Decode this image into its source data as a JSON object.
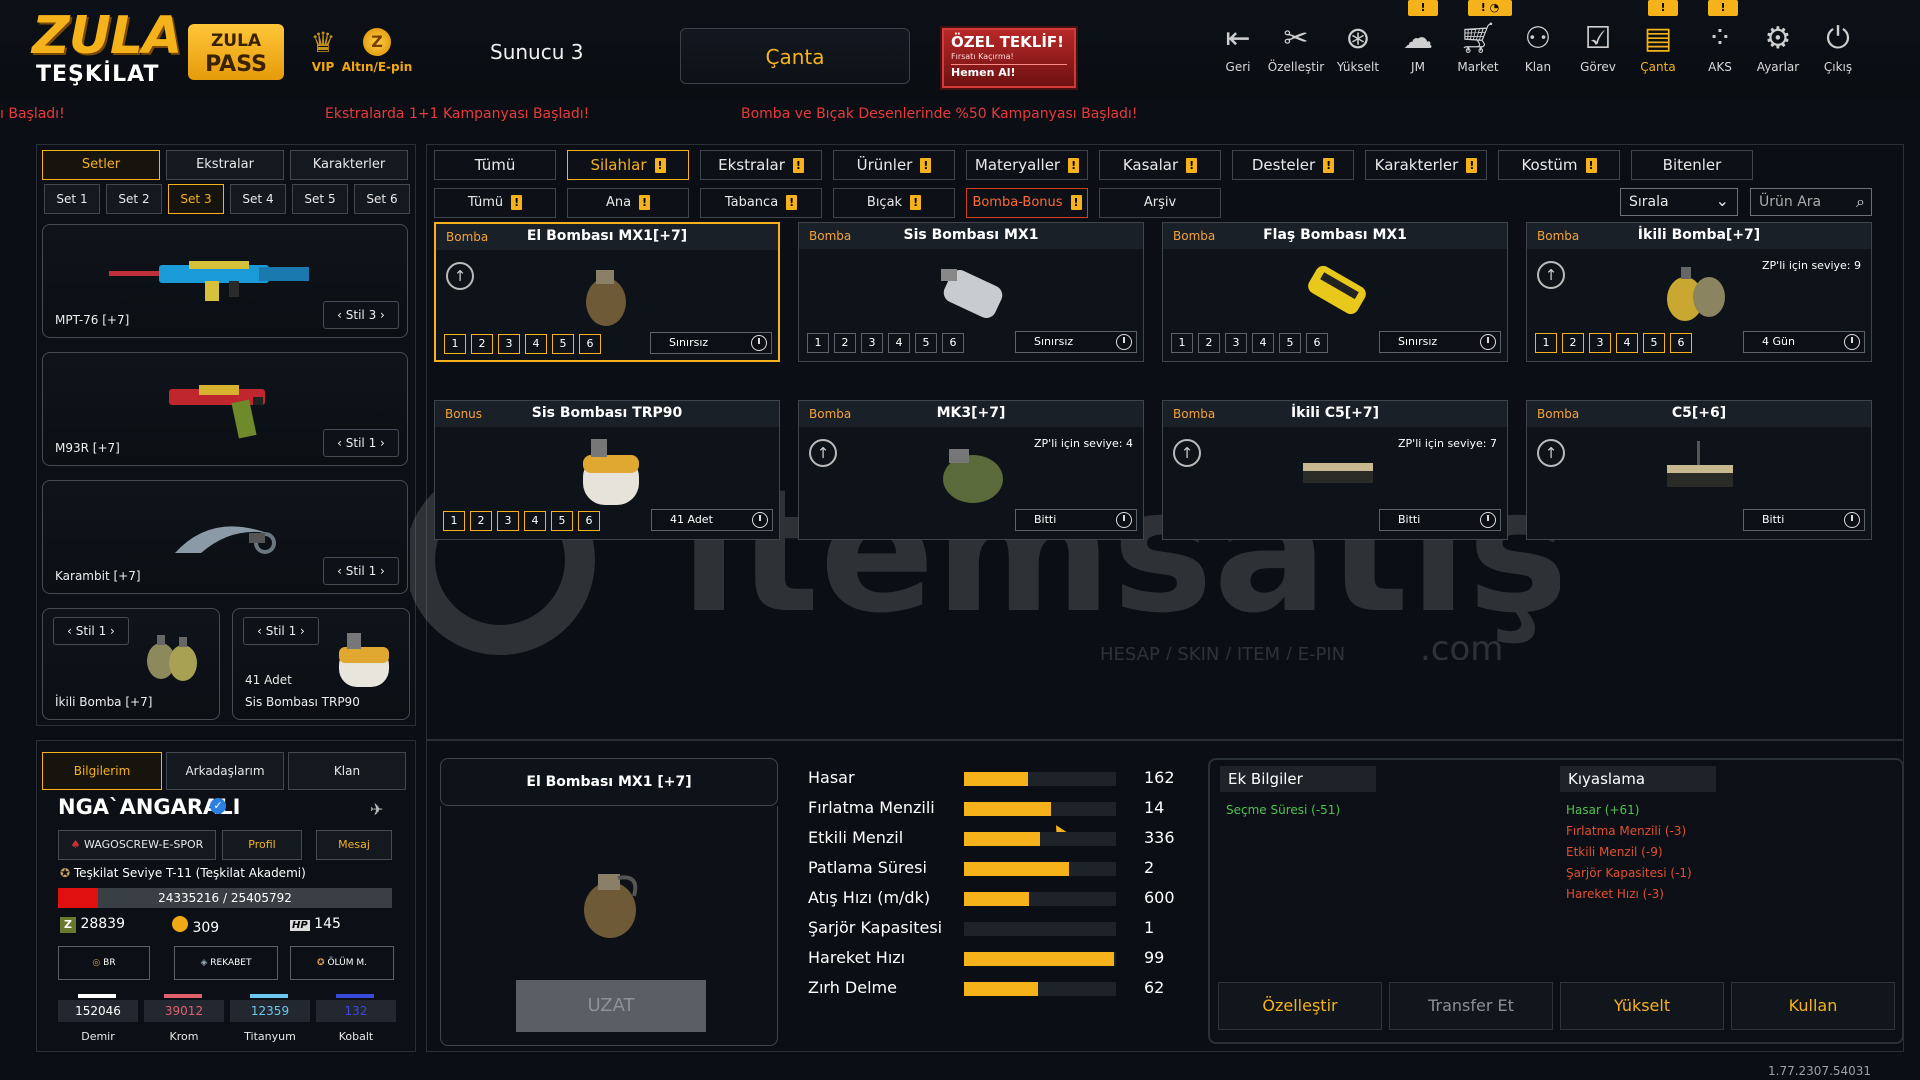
{
  "top": {
    "logo_line1": "ZULA",
    "logo_line2": "TEŞKİLAT",
    "pass1": "ZULA",
    "pass2": "PASS",
    "vip": "VIP",
    "altin": "Altın/E-pin",
    "server": "Sunucu 3",
    "canta": "Çanta",
    "offer": {
      "title": "ÖZEL TEKLİF!",
      "sub": "Fırsatı Kaçırma!",
      "cta": "Hemen Al!"
    },
    "nav": [
      {
        "label": "Geri",
        "icon": "back-icon"
      },
      {
        "label": "Özelleştir",
        "icon": "wrench-icon"
      },
      {
        "label": "Yükselt",
        "icon": "upgrade-icon"
      },
      {
        "label": "JM",
        "icon": "chat-icon"
      },
      {
        "label": "Market",
        "icon": "cart-icon"
      },
      {
        "label": "Klan",
        "icon": "people-icon"
      },
      {
        "label": "Görev",
        "icon": "clipboard-icon"
      },
      {
        "label": "Çanta",
        "icon": "bag-icon"
      },
      {
        "label": "AKS",
        "icon": "dots-icon"
      },
      {
        "label": "Ayarlar",
        "icon": "gear-icon"
      },
      {
        "label": "Çıkış",
        "icon": "power-icon"
      }
    ],
    "badges": [
      "!",
      "! ◔",
      "!",
      "!"
    ]
  },
  "ticker": [
    "ı Başladı!",
    "Ekstralarda 1+1 Kampanyası Başladı!",
    "Bomba ve Bıçak Desenlerinde %50 Kampanyası Başladı!"
  ],
  "left": {
    "tabs": [
      "Setler",
      "Ekstralar",
      "Karakterler"
    ],
    "sets": [
      "Set 1",
      "Set 2",
      "Set 3",
      "Set 4",
      "Set 5",
      "Set 6"
    ],
    "cards": [
      {
        "name": "MPT-76 [+7]",
        "stil": "Stil 3"
      },
      {
        "name": "M93R [+7]",
        "stil": "Stil 1"
      },
      {
        "name": "Karambit [+7]",
        "stil": "Stil 1"
      }
    ],
    "small": [
      {
        "name": "İkili Bomba [+7]",
        "stil": "Stil 1",
        "extra": ""
      },
      {
        "name": "Sis Bombası TRP90",
        "stil": "Stil 1",
        "extra": "41 Adet"
      }
    ]
  },
  "profile": {
    "tabs": [
      "Bilgilerim",
      "Arkadaşlarım",
      "Klan"
    ],
    "name": "NGA`ANGARALI",
    "clan": "WAGOSCREW-E-SPOR",
    "profil": "Profil",
    "mesaj": "Mesaj",
    "rank": "Teşkilat Seviye T-11 (Teşkilat Akademi)",
    "xp": "24335216 / 25405792",
    "xp_fraction": 0.12,
    "zp": "28839",
    "gold": "309",
    "hp_label": "HP",
    "hp": "145",
    "buttons": [
      "BR",
      "REKABET",
      "ÖLÜM M."
    ],
    "materials": [
      {
        "name": "Demir",
        "value": "152046",
        "color": "#ffffff"
      },
      {
        "name": "Krom",
        "value": "39012",
        "color": "#e0606e"
      },
      {
        "name": "Titanyum",
        "value": "12359",
        "color": "#6cc8f0"
      },
      {
        "name": "Kobalt",
        "value": "132",
        "color": "#3a4ad8"
      }
    ]
  },
  "filters": {
    "row1": [
      {
        "label": "Tümü",
        "ex": false
      },
      {
        "label": "Silahlar",
        "ex": true,
        "on": true
      },
      {
        "label": "Ekstralar",
        "ex": true
      },
      {
        "label": "Ürünler",
        "ex": true
      },
      {
        "label": "Materyaller",
        "ex": true
      },
      {
        "label": "Kasalar",
        "ex": true
      },
      {
        "label": "Desteler",
        "ex": true
      },
      {
        "label": "Karakterler",
        "ex": true
      },
      {
        "label": "Kostüm",
        "ex": true
      },
      {
        "label": "Bitenler",
        "ex": false
      }
    ],
    "row2": [
      {
        "label": "Tümü",
        "ex": true
      },
      {
        "label": "Ana",
        "ex": true
      },
      {
        "label": "Tabanca",
        "ex": true
      },
      {
        "label": "Bıçak",
        "ex": true
      },
      {
        "label": "Bomba-Bonus",
        "ex": true,
        "on": true
      },
      {
        "label": "Arşiv",
        "ex": false
      }
    ],
    "sort": "Sırala",
    "search_placeholder": "Ürün Ara"
  },
  "items": [
    {
      "type": "Bomba",
      "title": "El Bombası MX1[+7]",
      "levels": true,
      "zp": "",
      "duration": "Sınırsız",
      "up": true,
      "sel": true
    },
    {
      "type": "Bomba",
      "title": "Sis Bombası MX1",
      "levels": true,
      "zp": "",
      "duration": "Sınırsız",
      "up": false
    },
    {
      "type": "Bomba",
      "title": "Flaş Bombası MX1",
      "levels": true,
      "zp": "",
      "duration": "Sınırsız",
      "up": false
    },
    {
      "type": "Bomba",
      "title": "İkili Bomba[+7]",
      "levels": true,
      "zp": "ZP'li için seviye: 9",
      "duration": "4 Gün",
      "up": true,
      "hl": true
    },
    {
      "type": "Bonus",
      "title": "Sis Bombası TRP90",
      "levels": true,
      "zp": "",
      "duration": "41 Adet",
      "up": false,
      "hl": true
    },
    {
      "type": "Bomba",
      "title": "MK3[+7]",
      "levels": false,
      "zp": "ZP'li için seviye: 4",
      "duration": "Bitti",
      "up": true
    },
    {
      "type": "Bomba",
      "title": "İkili C5[+7]",
      "levels": false,
      "zp": "ZP'li için seviye: 7",
      "duration": "Bitti",
      "up": true
    },
    {
      "type": "Bomba",
      "title": "C5[+6]",
      "levels": false,
      "zp": "",
      "duration": "Bitti",
      "up": true
    }
  ],
  "levels": [
    "1",
    "2",
    "3",
    "4",
    "5",
    "6"
  ],
  "detail": {
    "name": "El Bombası MX1 [+7]",
    "uzat": "UZAT",
    "stats": [
      {
        "label": "Hasar",
        "value": "162",
        "fill": 0.42
      },
      {
        "label": "Fırlatma Menzili",
        "value": "14",
        "fill": 0.57
      },
      {
        "label": "Etkili Menzil",
        "value": "336",
        "fill": 0.5
      },
      {
        "label": "Patlama Süresi",
        "value": "2",
        "fill": 0.69
      },
      {
        "label": "Atış Hızı (m/dk)",
        "value": "600",
        "fill": 0.43
      },
      {
        "label": "Şarjör Kapasitesi",
        "value": "1",
        "fill": 0
      },
      {
        "label": "Hareket Hızı",
        "value": "99",
        "fill": 0.99
      },
      {
        "label": "Zırh Delme",
        "value": "62",
        "fill": 0.49
      }
    ],
    "ek_title": "Ek Bilgiler",
    "ek_items": [
      "Seçme Süresi (-51)"
    ],
    "cmp_title": "Kıyaslama",
    "cmp_items": [
      {
        "t": "Hasar (+61)",
        "c": "#4ec24e"
      },
      {
        "t": "Fırlatma Menzili (-3)",
        "c": "#e05030"
      },
      {
        "t": "Etkili Menzil (-9)",
        "c": "#e05030"
      },
      {
        "t": "Şarjör Kapasitesi (-1)",
        "c": "#e05030"
      },
      {
        "t": "Hareket Hızı (-3)",
        "c": "#e05030"
      }
    ],
    "actions": [
      "Özelleştir",
      "Transfer Et",
      "Yükselt",
      "Kullan"
    ]
  },
  "version": "1.77.2307.54031",
  "watermark": {
    "brand": "itemsatış",
    "tag": "HESAP / SKIN / ITEM / E-PIN",
    "com": ".com"
  }
}
